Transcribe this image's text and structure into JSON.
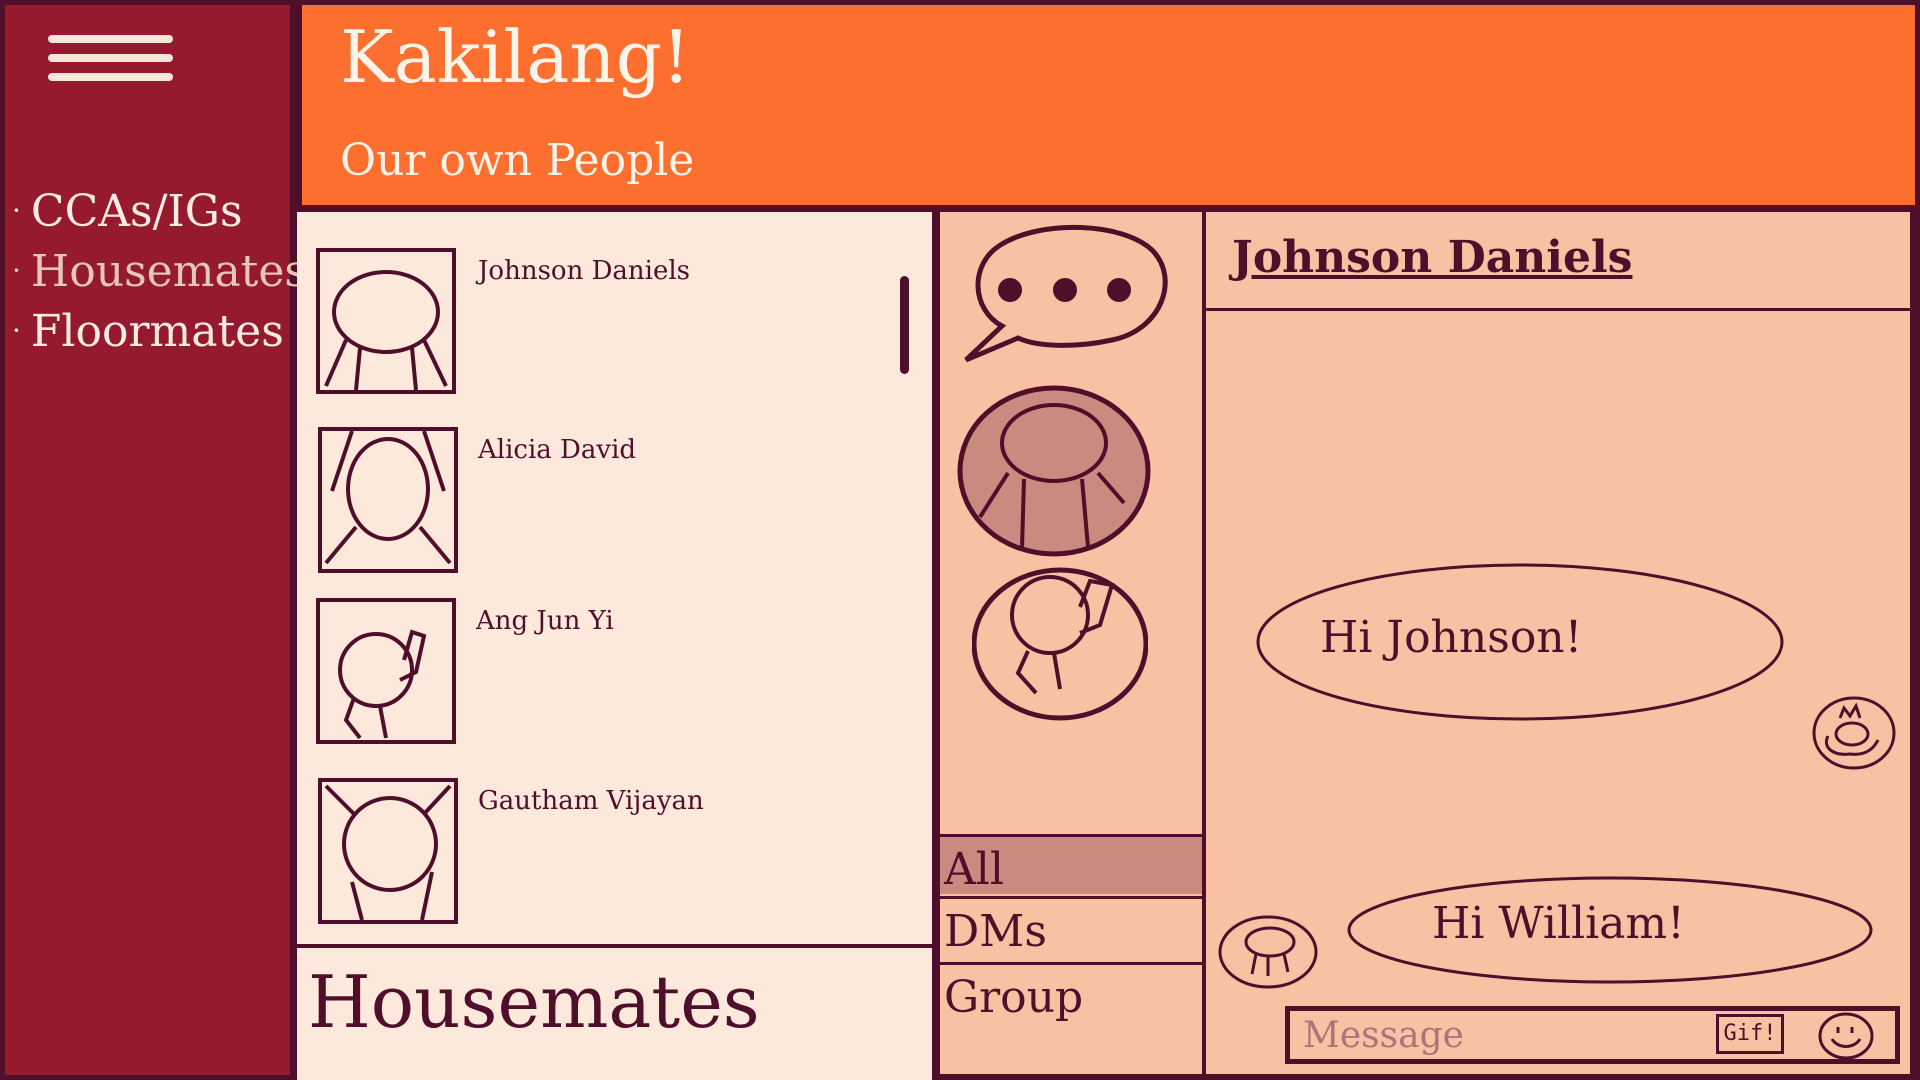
{
  "header": {
    "title": "Kakilang!",
    "subtitle": "Our own People"
  },
  "sidebar": {
    "items": [
      {
        "label": "CCAs/IGs",
        "bullet": "·",
        "active": false
      },
      {
        "label": "Housemates",
        "bullet": "·",
        "active": true
      },
      {
        "label": "Floormates",
        "bullet": "·",
        "active": false
      }
    ]
  },
  "contacts": {
    "section_title": "Housemates",
    "list": [
      {
        "name": "Johnson Daniels"
      },
      {
        "name": "Alicia David"
      },
      {
        "name": "Ang Jun Yi"
      },
      {
        "name": "Gautham Vijayan"
      }
    ]
  },
  "channels": {
    "filters": [
      {
        "label": "All",
        "active": true
      },
      {
        "label": "DMs",
        "active": false
      },
      {
        "label": "Group",
        "active": false
      }
    ],
    "icons": [
      "chat-bubble-icon",
      "avatar-johnson-daniels",
      "avatar-ang-jun-yi"
    ]
  },
  "chat": {
    "contact_name": "Johnson Daniels",
    "messages": [
      {
        "text": "Hi Johnson!",
        "from": "self"
      },
      {
        "text": "Hi William!",
        "from": "other"
      }
    ],
    "input_placeholder": "Message",
    "gif_label": "Gif!"
  },
  "colors": {
    "background": "#4f0f2b",
    "sidebar": "#951a2e",
    "header": "#fd6f2f",
    "contacts_panel": "#fde8dc",
    "chat_panel": "#f8c1a3",
    "active_filter": "#c98a80"
  }
}
